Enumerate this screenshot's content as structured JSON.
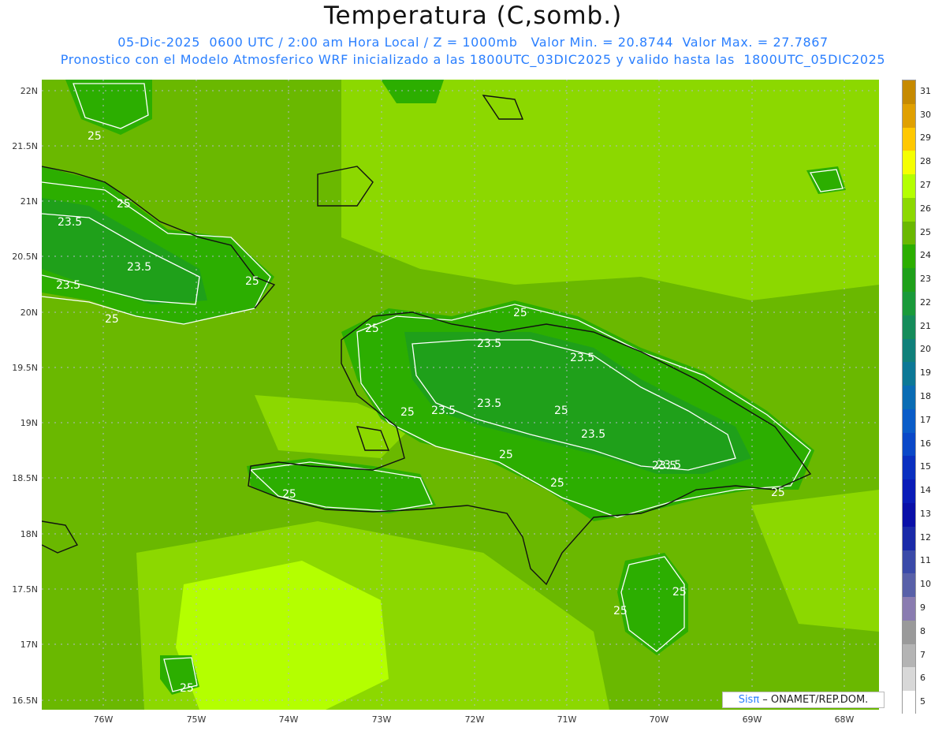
{
  "title": "Temperatura (C,somb.)",
  "subtitle1": "05-Dic-2025  0600 UTC / 2:00 am Hora Local / Z = 1000mb   Valor Min. = 20.8744  Valor Max. = 27.7867",
  "subtitle2": "Pronostico con el Modelo Atmosferico WRF inicializado a las 1800UTC_03DIC2025 y valido hasta las  1800UTC_05DIC2025",
  "credit": {
    "brand": "Sisπ",
    "text": " –  ONAMET/REP.DOM."
  },
  "lat_labels": [
    "22N",
    "21.5N",
    "21N",
    "20.5N",
    "20N",
    "19.5N",
    "19N",
    "18.5N",
    "18N",
    "17.5N",
    "17N",
    "16.5N"
  ],
  "lon_labels": [
    "76W",
    "75W",
    "74W",
    "73W",
    "72W",
    "71W",
    "70W",
    "69W",
    "68W"
  ],
  "colorbar": {
    "levels": [
      "31",
      "30",
      "29",
      "28",
      "27",
      "26",
      "25",
      "24",
      "23",
      "22",
      "21",
      "20",
      "19",
      "18",
      "17",
      "16",
      "15",
      "14",
      "13",
      "12",
      "11",
      "10",
      "9",
      "8",
      "7",
      "6",
      "5"
    ],
    "colors": [
      "#c68a00",
      "#e0a000",
      "#ffc800",
      "#f5ff00",
      "#b4ff00",
      "#8cd800",
      "#6ab800",
      "#2cae00",
      "#1fa01a",
      "#1a9a3a",
      "#158c5a",
      "#10807a",
      "#0c7896",
      "#0a6cb4",
      "#0a5cc8",
      "#0a48c8",
      "#0a30c0",
      "#0a1cb8",
      "#0a10a8",
      "#1a2aa8",
      "#3a4aa8",
      "#5860a8",
      "#8a7cb0",
      "#9a9a9a",
      "#b4b4b4",
      "#d8d8d8",
      "#ffffff"
    ]
  },
  "contour_labels": [
    {
      "text": "25"
    },
    {
      "text": "25"
    },
    {
      "text": "23.5"
    },
    {
      "text": "23.5"
    },
    {
      "text": "23.5"
    },
    {
      "text": "25"
    },
    {
      "text": "25"
    },
    {
      "text": "25"
    },
    {
      "text": "25"
    },
    {
      "text": "23.5"
    },
    {
      "text": "23.5"
    },
    {
      "text": "23.5"
    },
    {
      "text": "25"
    },
    {
      "text": "23.5"
    },
    {
      "text": "25"
    },
    {
      "text": "23.5"
    },
    {
      "text": "25"
    },
    {
      "text": "25"
    },
    {
      "text": "23.5"
    },
    {
      "text": "23.5"
    },
    {
      "text": "25"
    },
    {
      "text": "25"
    },
    {
      "text": "25"
    },
    {
      "text": "25"
    },
    {
      "text": "25"
    }
  ]
}
